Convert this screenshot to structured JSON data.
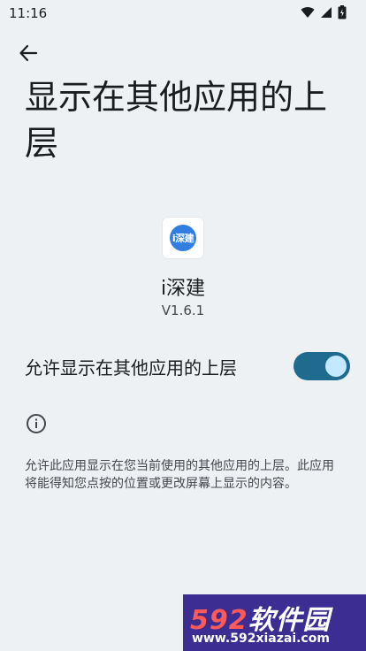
{
  "status_bar": {
    "time": "11:16"
  },
  "page": {
    "title": "显示在其他应用的上层"
  },
  "app": {
    "name": "i深建",
    "version": "V1.6.1",
    "icon_text": "i深建"
  },
  "toggle": {
    "label": "允许显示在其他应用的上层",
    "checked": true
  },
  "description": "允许此应用显示在您当前使用的其他应用的上层。此应用将能得知您点按的位置或更改屏幕上显示的内容。",
  "watermark": {
    "brand_num": "592",
    "brand_text": "软件园",
    "url": "www.592xiazai.com"
  },
  "colors": {
    "background": "#eef1f4",
    "switch_track": "#1e6b8f",
    "switch_thumb": "#c4e8ff",
    "app_icon": "#2f7ee0"
  }
}
